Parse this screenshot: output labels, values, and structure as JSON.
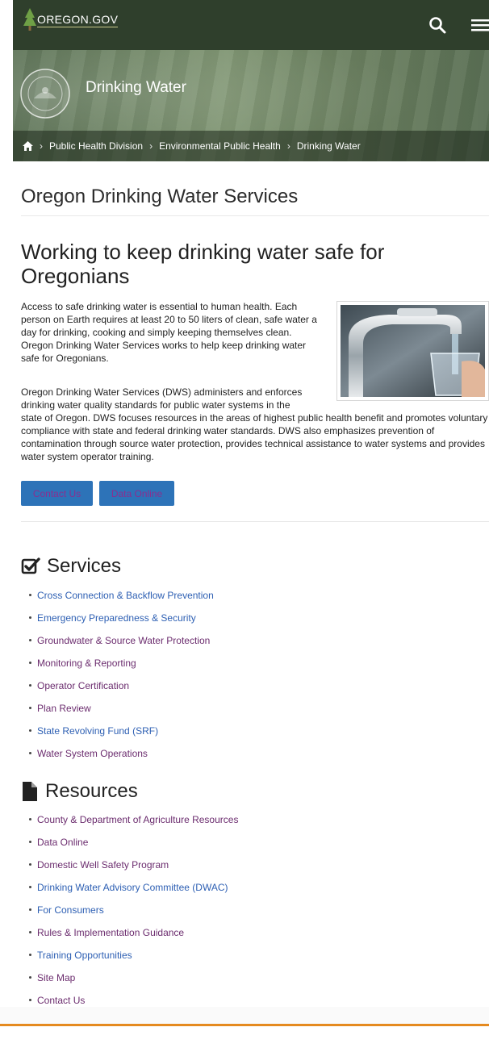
{
  "header": {
    "logo_text": "OREGON.GOV",
    "icons": {
      "search": "search-icon",
      "menu": "hamburger-menu-icon",
      "logo": "tree-icon"
    }
  },
  "hero": {
    "title": "Drinking Water",
    "seal_icon": "state-seal-icon"
  },
  "breadcrumb": {
    "home_icon": "home-icon",
    "items": [
      "Public Health Division",
      "Environmental Public Health",
      "Drinking Water"
    ]
  },
  "main": {
    "page_title": "Oregon Drinking Water Services",
    "heading": "Working to keep drinking water safe for Oregonians",
    "intro_p1": "Access to safe drinking water is essential to human health. Each person on Earth requires at least 20 to 50 liters of clean, safe water a day for drinking, cooking and simply keeping themselves clean. Oregon Drinking Water Services works to help keep drinking water safe for Oregonians.",
    "intro_p2_start": "Oregon Drinking Water Services (DWS) administers and enforces drinking water quality standards for public water systems in the",
    "intro_p2_end": "state of Oregon. DWS focuses resources in the areas of highest public health benefit and promotes voluntary compliance with state and federal drinking water standards. DWS also emphasizes prevention of contamination through source water protection, provides technical assistance to water systems and provides water system operator training.",
    "buttons": {
      "contact": "Contact Us",
      "data_online": "Data Online"
    }
  },
  "services": {
    "title": "Services",
    "icon": "checkbox-icon",
    "items": [
      {
        "label": "Cross Connection & Backflow Prevention",
        "color": "#2d5fb3"
      },
      {
        "label": "Emergency Preparedness & Security",
        "color": "#2d5fb3"
      },
      {
        "label": "Groundwater & Source Water Protection",
        "color": "#6b2c6e"
      },
      {
        "label": "Monitoring & Reporting",
        "color": "#6b2c6e"
      },
      {
        "label": "Operator Certification",
        "color": "#6b2c6e"
      },
      {
        "label": "Plan Review",
        "color": "#6b2c6e"
      },
      {
        "label": "State Revolving Fund (SRF)",
        "color": "#2d5fb3"
      },
      {
        "label": "Water System Operations",
        "color": "#6b2c6e"
      }
    ]
  },
  "resources": {
    "title": "Resources",
    "icon": "document-icon",
    "items": [
      {
        "label": "County & Department of Agriculture Resources",
        "color": "#6b2c6e"
      },
      {
        "label": "Data Online",
        "color": "#6b2c6e"
      },
      {
        "label": "Domestic Well Safety Program",
        "color": "#6b2c6e"
      },
      {
        "label": "Drinking Water Advisory Committee (DWAC)",
        "color": "#2d5fb3"
      },
      {
        "label": "For Consumers",
        "color": "#2d5fb3"
      },
      {
        "label": "Rules & Implementation Guidance",
        "color": "#6b2c6e"
      },
      {
        "label": "Training Opportunities",
        "color": "#2d5fb3"
      },
      {
        "label": "Site Map",
        "color": "#6b2c6e"
      },
      {
        "label": "Contact Us",
        "color": "#6b2c6e"
      }
    ]
  },
  "colors": {
    "topbar": "#2f3f2c",
    "button": "#2d73b8",
    "footer_accent": "#e58a1f"
  }
}
